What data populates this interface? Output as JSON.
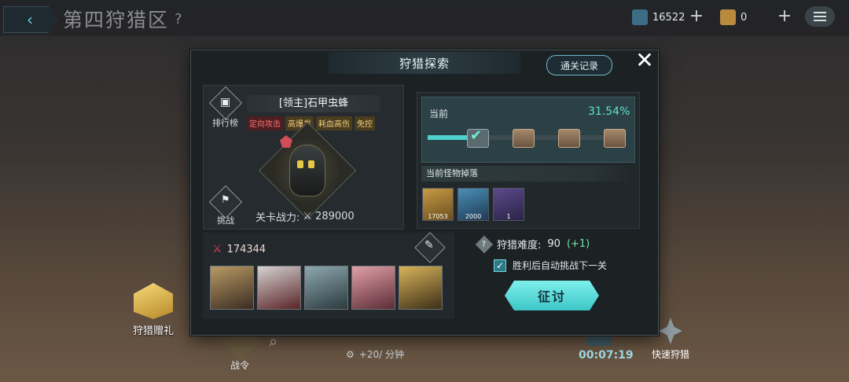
{
  "header": {
    "back_icon": "chevron-left-icon",
    "title": "第四狩猎区",
    "help": "?",
    "currency_a": "16522",
    "currency_b": "0"
  },
  "hud": {
    "gift_label": "狩猎赠礼",
    "battle_pass_label": "战令",
    "rate": "+20/ 分钟",
    "timer": "00:07:19",
    "quick_hunt_label": "快速狩猎"
  },
  "dialog": {
    "title": "狩猎探索",
    "record_button": "通关记录",
    "close": "✕",
    "boss": {
      "rank_label": "排行榜",
      "name": "[领主]石甲虫蜂",
      "tags": [
        "定向攻击",
        "高爆发",
        "耗血高伤",
        "免控"
      ],
      "challenge_label": "挑战",
      "power_label": "关卡战力:",
      "power_value": "289000"
    },
    "progress": {
      "current_label": "当前",
      "percent": "31.54%",
      "percent_value": 31.54,
      "drops_label": "当前怪物掉落",
      "drops": [
        {
          "count": "17053",
          "icon": "gold-material-icon"
        },
        {
          "count": "2000",
          "icon": "crystal-icon"
        },
        {
          "count": "1",
          "icon": "drill-icon"
        }
      ]
    },
    "team": {
      "power": "174344",
      "heroes": [
        {
          "name": "hero-1"
        },
        {
          "name": "hero-2"
        },
        {
          "name": "hero-3"
        },
        {
          "name": "hero-4"
        },
        {
          "name": "hero-5"
        }
      ]
    },
    "difficulty": {
      "label": "狩猎难度:",
      "value": "90",
      "delta": "(+1)"
    },
    "auto_challenge_label": "胜利后自动挑战下一关",
    "auto_challenge_checked": true,
    "attack_button": "征讨"
  }
}
